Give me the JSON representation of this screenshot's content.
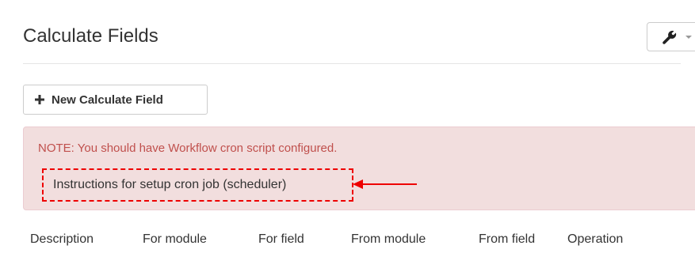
{
  "page": {
    "title": "Calculate Fields"
  },
  "toolbar": {
    "tools_icon": "wrench-icon",
    "dropdown_icon": "caret-down-icon"
  },
  "actions": {
    "new_button_label": "New Calculate Field",
    "new_button_icon": "plus-icon"
  },
  "alert": {
    "note": "NOTE: You should have Workflow cron script configured.",
    "instructions_link": "Instructions for setup cron job (scheduler)",
    "annotation_icon": "red-arrow-icon"
  },
  "table": {
    "columns": [
      "Description",
      "For module",
      "For field",
      "From module",
      "From field",
      "Operation"
    ]
  },
  "colors": {
    "alert_background": "#f2dede",
    "alert_text": "#c0504d",
    "highlight_red": "#ee0000"
  }
}
